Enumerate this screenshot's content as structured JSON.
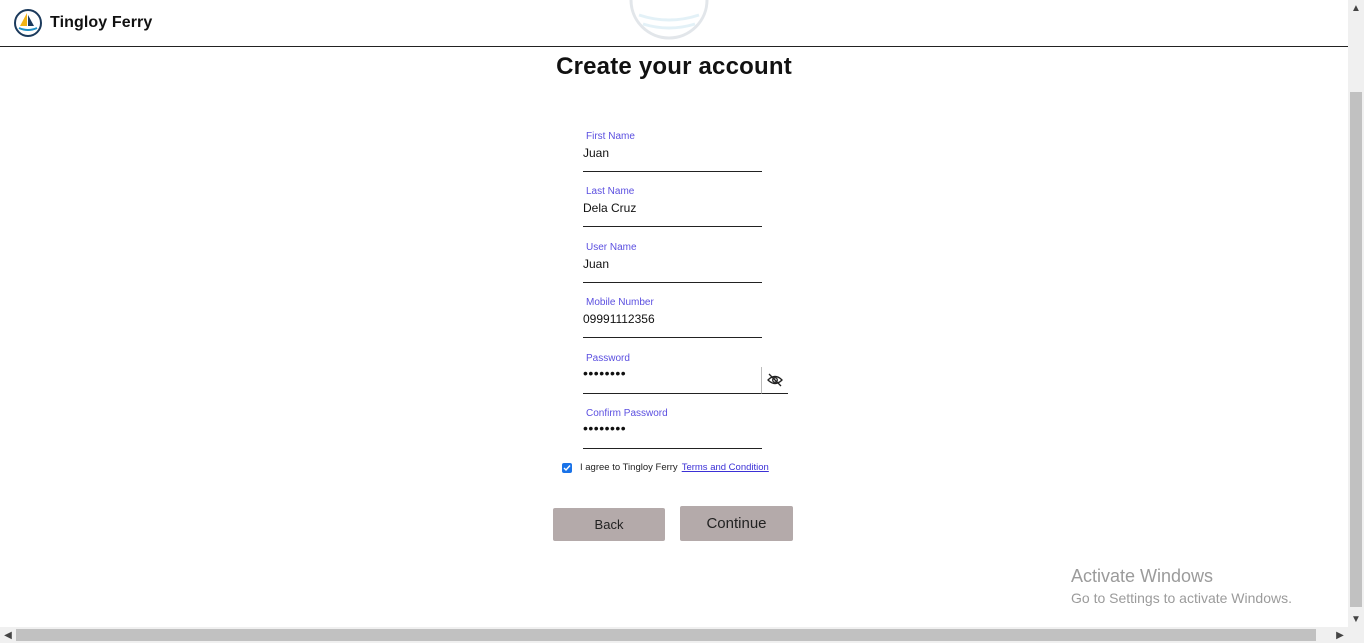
{
  "header": {
    "brand_name": "Tingloy Ferry",
    "logo_icon": "sailboat-logo-icon"
  },
  "page": {
    "title": "Create your account"
  },
  "form": {
    "first_name": {
      "label": "First Name",
      "value": "Juan"
    },
    "last_name": {
      "label": "Last Name",
      "value": "Dela Cruz"
    },
    "user_name": {
      "label": "User Name",
      "value": "Juan"
    },
    "mobile_number": {
      "label": "Mobile Number",
      "value": "09991112356"
    },
    "password": {
      "label": "Password",
      "masked": "••••••••",
      "toggle_icon": "eye-off-icon"
    },
    "confirm_password": {
      "label": "Confirm Password",
      "masked": "••••••••"
    },
    "agree": {
      "text": "I agree to Tingloy Ferry",
      "link": "Terms and Condition",
      "checked": true
    }
  },
  "buttons": {
    "back": "Back",
    "continue": "Continue"
  },
  "watermark": {
    "title": "Activate Windows",
    "subtitle": "Go to Settings to activate Windows."
  },
  "colors": {
    "label": "#5b4fe0",
    "button_bg": "#b4aaaa",
    "link": "#3b30d6",
    "checkbox": "#1a73e8"
  }
}
